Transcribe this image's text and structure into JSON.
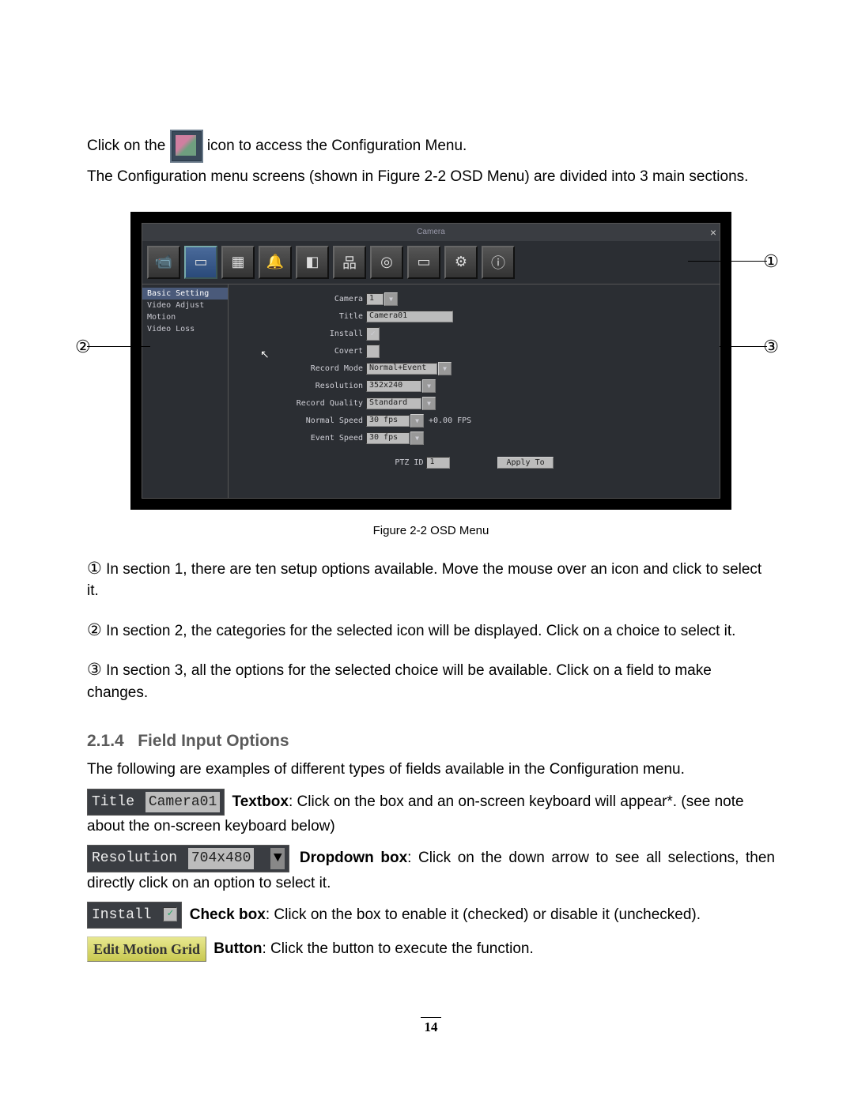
{
  "intro": {
    "line1a": "Click on the ",
    "line1b": " icon to access the Configuration Menu.",
    "line2": "The Configuration menu screens (shown in Figure 2-2 OSD Menu) are divided into 3 main sections."
  },
  "window": {
    "title": "Camera",
    "toolbar_icons": [
      "camera",
      "monitor",
      "grid",
      "alarm",
      "dim",
      "network",
      "disk",
      "display",
      "gear",
      "info"
    ],
    "sidebar": [
      "Basic Setting",
      "Video Adjust",
      "Motion",
      "Video Loss"
    ],
    "fields": {
      "camera_label": "Camera",
      "camera_value": "1",
      "title_label": "Title",
      "title_value": "Camera01",
      "install_label": "Install",
      "install_checked": "✓",
      "covert_label": "Covert",
      "recmode_label": "Record Mode",
      "recmode_value": "Normal+Event",
      "res_label": "Resolution",
      "res_value": "352x240",
      "quality_label": "Record Quality",
      "quality_value": "Standard",
      "nspeed_label": "Normal Speed",
      "nspeed_value": "30 fps",
      "nspeed_suffix": "+0.00 FPS",
      "espeed_label": "Event Speed",
      "espeed_value": "30 fps",
      "ptz_label": "PTZ ID",
      "ptz_value": "1",
      "apply": "Apply To"
    }
  },
  "callouts": {
    "c1": "①",
    "c2": "②",
    "c3": "③"
  },
  "caption": "Figure 2-2 OSD Menu",
  "notes": {
    "n1": "In section 1, there are ten setup options available. Move the mouse over an icon and click to select it.",
    "n2": "In section 2, the categories for the selected icon will be displayed. Click on a choice to select it.",
    "n3": "In section 3, all the options for the selected choice will be available. Click on a field to make changes."
  },
  "section": {
    "num": "2.1.4",
    "title": "Field Input Options"
  },
  "section_intro": "The following are examples of different types of fields available in the Configuration menu.",
  "examples": {
    "textbox": {
      "chip_label": "Title",
      "chip_value": "Camera01",
      "name": "Textbox",
      "desc": ": Click on the box and an on-screen keyboard will appear*. (see note about the on-screen keyboard below)"
    },
    "dropdown": {
      "chip_label": "Resolution",
      "chip_value": "704x480",
      "name": "Dropdown box",
      "desc": ": Click on the down arrow to see all selections, then directly click on an option to select it."
    },
    "checkbox": {
      "chip_label": "Install",
      "name": "Check box",
      "desc": ": Click on the box to enable it (checked) or disable it (unchecked)."
    },
    "button": {
      "chip_label": "Edit Motion Grid",
      "name": "Button",
      "desc": ": Click the button to execute the function."
    }
  },
  "page_number": "14"
}
